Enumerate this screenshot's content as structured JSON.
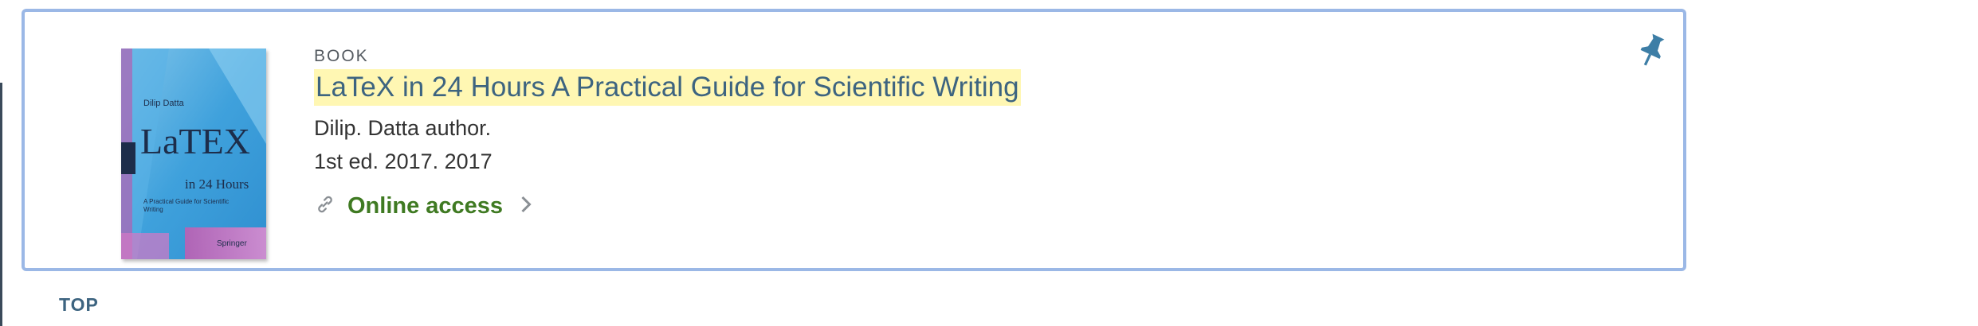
{
  "record": {
    "type_label": "BOOK",
    "title": "LaTeX in 24 Hours A Practical Guide for Scientific Writing",
    "author": "Dilip. Datta author.",
    "edition": "1st ed. 2017. 2017",
    "access_label": "Online access",
    "cover": {
      "author_text": "Dilip Datta",
      "logo_text": "LaTEX",
      "subtitle_text": "in 24 Hours",
      "tagline_text": "A Practical Guide for Scientific Writing",
      "publisher_text": "Springer"
    }
  },
  "nav": {
    "top_label": "TOP"
  },
  "colors": {
    "card_border": "#9bb8e6",
    "title_link": "#3d6480",
    "highlight": "#fff7b3",
    "access_green": "#3f7a22",
    "pin": "#3d7ea6"
  },
  "icons": [
    "link-icon",
    "chevron-right-icon",
    "pin-icon"
  ]
}
